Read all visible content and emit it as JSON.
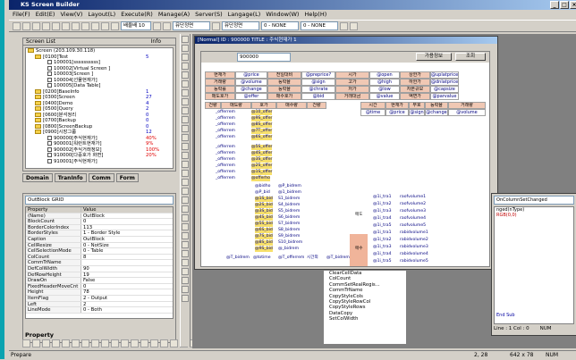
{
  "app": {
    "title": "KS Screen Builder"
  },
  "menu": [
    "File(F)",
    "Edit(E)",
    "View(V)",
    "Layout(L)",
    "Execute(R)",
    "Manage(A)",
    "Server(S)",
    "Langage(L)",
    "Window(W)",
    "Help(H)"
  ],
  "toolbar": {
    "zoom": "배율배 10",
    "font_combo": "뮤단정면",
    "none1": "0 - NONE",
    "none2": "0 - NONE"
  },
  "screen_list": {
    "title": "Screen List",
    "info": "Info",
    "items": [
      {
        "label": "Screen (203.109.30.118)",
        "val": ""
      },
      {
        "label": "[0100]Test",
        "val": "5"
      },
      {
        "label": "100001[ssssssssss]",
        "val": ""
      },
      {
        "label": "100002[Virtual Screen ]",
        "val": ""
      },
      {
        "label": "100003[Screen ]",
        "val": ""
      },
      {
        "label": "100004[선물현재가]",
        "val": ""
      },
      {
        "label": "100005[Data Table]",
        "val": ""
      },
      {
        "label": "[0200]BaseInfo",
        "val": "1"
      },
      {
        "label": "[0300]Screen",
        "val": "27"
      },
      {
        "label": "[0400]Demo",
        "val": "4"
      },
      {
        "label": "[0500]Query",
        "val": "2"
      },
      {
        "label": "[0600]분석정리",
        "val": "0"
      },
      {
        "label": "[0700]Backup",
        "val": "0"
      },
      {
        "label": "[0800]ScreenBackup",
        "val": "0"
      },
      {
        "label": "[0900]시장그룹",
        "val": "12"
      },
      {
        "label": "900000[주식현재가]",
        "val": "40%"
      },
      {
        "label": "900001[워런트현재가]",
        "val": "9%"
      },
      {
        "label": "900002[주식거래정보]",
        "val": "100%"
      },
      {
        "label": "910000[다중호가 화면]",
        "val": "20%"
      },
      {
        "label": "910001[주식현재가]",
        "val": ""
      }
    ]
  },
  "left_tabs": [
    "Domain",
    "TranInfo",
    "Comm",
    "Form"
  ],
  "property": {
    "object": "OutBlock GRID",
    "col_prop": "Property",
    "col_val": "Value",
    "rows": [
      [
        "(Name)",
        "OutBlock"
      ],
      [
        "BlockCount",
        "0"
      ],
      [
        "BorderColorIndex",
        "113"
      ],
      [
        "BorderStyles",
        "1 - Border Style"
      ],
      [
        "Caption",
        "OutBlock"
      ],
      [
        "CellResize",
        "0 - NotSize"
      ],
      [
        "CellSelectionMode",
        "0 - Table"
      ],
      [
        "ColCount",
        "8"
      ],
      [
        "CommTrName",
        ""
      ],
      [
        "DefColWidth",
        "90"
      ],
      [
        "DefRowHeight",
        "19"
      ],
      [
        "DrawOn",
        "False"
      ],
      [
        "FixedHeaderMoveCnt",
        "0"
      ],
      [
        "Height",
        "78"
      ],
      [
        "ItemFlag",
        "2 - Output"
      ],
      [
        "Left",
        "2"
      ],
      [
        "LineMode",
        "0 - Both"
      ]
    ],
    "footer": "Property"
  },
  "designer": {
    "title": "[Normal] ID : 900000 TITLE : 주식현재가 1",
    "code": "900000",
    "btn_query": "가용정보",
    "btn_search": "조회",
    "top_rows": [
      [
        "현재가",
        "@price",
        "전일대비",
        "@preprice?",
        "시가",
        "@open",
        "상한가",
        "@uplatprice"
      ],
      [
        "거래량",
        "@volume",
        "등락율",
        "@sign",
        "고가",
        "@high",
        "하한가",
        "@dnlatprice"
      ],
      [
        "등락률",
        "@change",
        "등락율",
        "@chrate",
        "저가",
        "@low",
        "자본규모",
        "@capsize"
      ],
      [
        "매도호가",
        "@offer",
        "매수호가",
        "@bid",
        "거래대금",
        "@value",
        "액면가",
        "@parvalue"
      ]
    ],
    "grid_header": [
      "건량",
      "매도량",
      "호가",
      "매수량",
      "건량"
    ],
    "grid2_header": [
      "시간",
      "현재가",
      "부호",
      "등락율",
      "거래량"
    ],
    "grid2_row": [
      "@time",
      "@price",
      "@sign",
      "@change",
      "@volume"
    ],
    "offer_rows": [
      "_offerrem",
      "_offerrem",
      "_offerrem",
      "_offerrem",
      "_offerrem"
    ],
    "offer_prices": [
      "@10_offer",
      "@9S_offer",
      "@8S_offer",
      "@7T_offer",
      "@6S_offer"
    ],
    "offer_rows2": [
      "_offerrem",
      "_offerrem",
      "_offerrem",
      "_offerrem",
      "_offerrem",
      "_offerrem"
    ],
    "offer_prices2": [
      "@5S_offer",
      "@4S_offer",
      "@3S_offer",
      "@2S_offer",
      "@1S_offer",
      "@offerho"
    ],
    "bid_prices": [
      "@bidho",
      "@P_bid",
      "@1S_bid",
      "@2S_bid",
      "@3S_bid",
      "@4S_bid",
      "@5S_bid",
      "@6S_bid",
      "@7S_bid",
      "@8S_bid",
      "@9S_bid"
    ],
    "bid_rems": [
      "@P_bidrem",
      "@1_bidrem",
      "S1_bidrem",
      "S4_bidrem",
      "S5_bidrem",
      "S6_bidrem",
      "S7_bidrem",
      "S8_bidrem",
      "S9_bidrem",
      "S10_bidrem",
      "@_bidrem"
    ],
    "footer_row": [
      "@T_bidrem",
      "@totime",
      "@T_offerrem",
      "시간외",
      "@T_bidrem"
    ],
    "sell_label": "매도",
    "buy_label": "매수",
    "sell_rows": [
      [
        "@1i_tra1",
        "raofvolume1"
      ],
      [
        "@1i_tra2",
        "raofvolume2"
      ],
      [
        "@1i_tra3",
        "raofvolume3"
      ],
      [
        "@1i_tra4",
        "raofvolume4"
      ],
      [
        "@1i_tra5",
        "raofvolume5"
      ]
    ],
    "buy_rows": [
      [
        "@1i_tra1",
        "rabidvolume1"
      ],
      [
        "@1i_tra2",
        "rabidvolume2"
      ],
      [
        "@1i_tra3",
        "rabidvolume3"
      ],
      [
        "@1i_tra4",
        "rabidvolume4"
      ],
      [
        "@1i_tra5",
        "rabidvolume5"
      ]
    ]
  },
  "events": [
    "ClearCellData",
    "ColCount",
    "CommSetRealRegis...",
    "CommTrName",
    "CopyStyleCols",
    "CopyStyleRowCol",
    "CopyStyleRows",
    "DataCopy",
    "SetColWidth"
  ],
  "code_panel": {
    "combo": "OnColumnSetChanged",
    "lines": [
      "nged(nType)",
      "RGB(0,0)"
    ],
    "end": "End Sub",
    "status": "Line : 1 Col : 0",
    "num": "NUM"
  },
  "status": {
    "left": "Prepare",
    "pos": "2, 28",
    "size": "642 x 78",
    "num": "NUM"
  }
}
